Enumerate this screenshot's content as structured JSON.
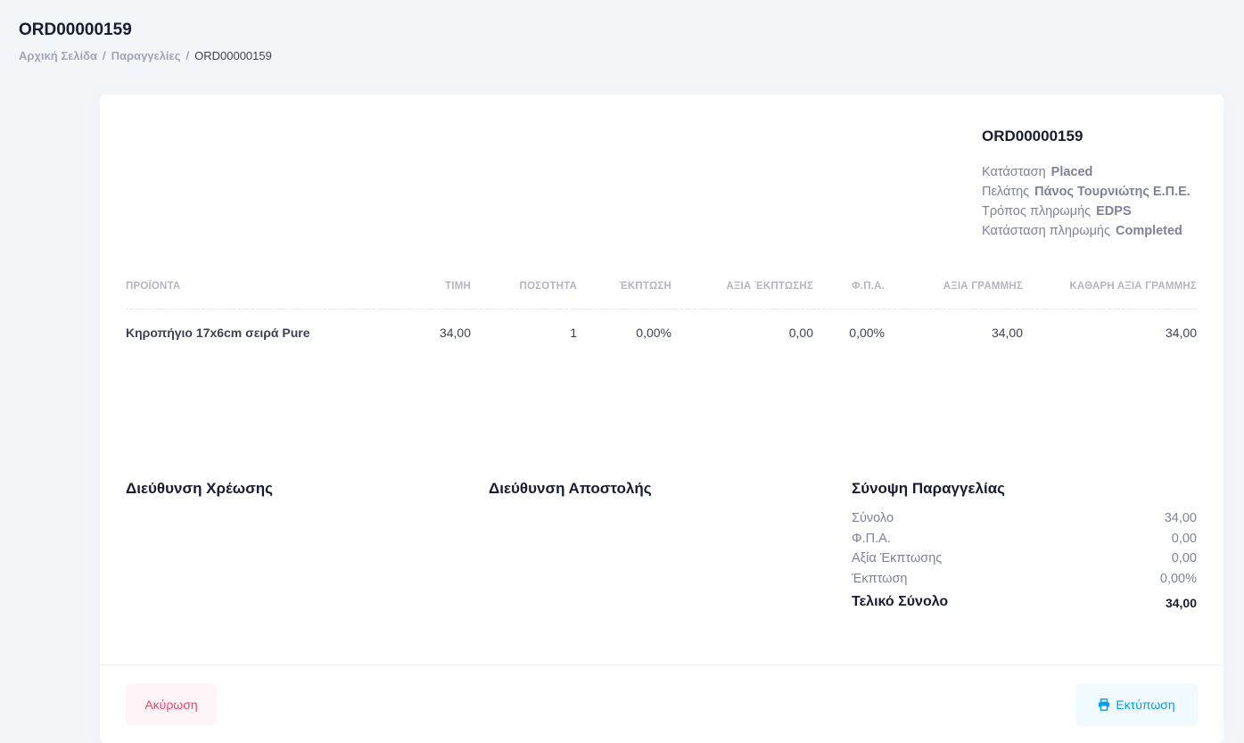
{
  "header": {
    "title": "ORD00000159",
    "breadcrumb": {
      "home": "Αρχική Σελίδα",
      "orders": "Παραγγελίες",
      "current": "ORD00000159",
      "separator": "/"
    }
  },
  "order_info": {
    "number": "ORD00000159",
    "rows": [
      {
        "label": "Κατάσταση",
        "value": "Placed"
      },
      {
        "label": "Πελάτης",
        "value": "Πάνος Τουρνιώτης Ε.Π.Ε."
      },
      {
        "label": "Τρόπος πληρωμής",
        "value": "EDPS"
      },
      {
        "label": "Κατάσταση πληρωμής",
        "value": "Completed"
      }
    ]
  },
  "items_table": {
    "headers": [
      "ΠΡΟΪΟΝΤΑ",
      "ΤΙΜΗ",
      "ΠΟΣΟΤΗΤΑ",
      "ΈΚΠΤΩΣΗ",
      "ΑΞΙΑ ΈΚΠΤΩΣΗΣ",
      "Φ.Π.Α.",
      "ΑΞΙΑ ΓΡΑΜΜΗΣ",
      "ΚΑΘΑΡΗ ΑΞΙΑ ΓΡΑΜΜΗΣ"
    ],
    "rows": [
      {
        "product": "Κηροπήγιο 17x6cm σειρά Pure",
        "price": "34,00",
        "quantity": "1",
        "discount": "0,00%",
        "discount_value": "0,00",
        "vat": "0,00%",
        "line_value": "34,00",
        "net_line_value": "34,00"
      }
    ]
  },
  "billing_address": {
    "title": "Διεύθυνση Χρέωσης"
  },
  "shipping_address": {
    "title": "Διεύθυνση Αποστολής"
  },
  "summary": {
    "title": "Σύνοψη Παραγγελίας",
    "rows": [
      {
        "label": "Σύνολο",
        "value": "34,00"
      },
      {
        "label": "Φ.Π.Α.",
        "value": "0,00"
      },
      {
        "label": "Αξία Έκπτωσης",
        "value": "0,00"
      },
      {
        "label": "Έκπτωση",
        "value": "0,00%"
      }
    ],
    "total_label": "Τελικό Σύνολο",
    "total_value": "34,00"
  },
  "footer": {
    "cancel_label": "Ακύρωση",
    "print_label": "Εκτύπωση",
    "print_icon": "printer-icon"
  },
  "colors": {
    "background": "#f3f6f9",
    "cancel": "#f1416c",
    "print": "#009ef7"
  }
}
